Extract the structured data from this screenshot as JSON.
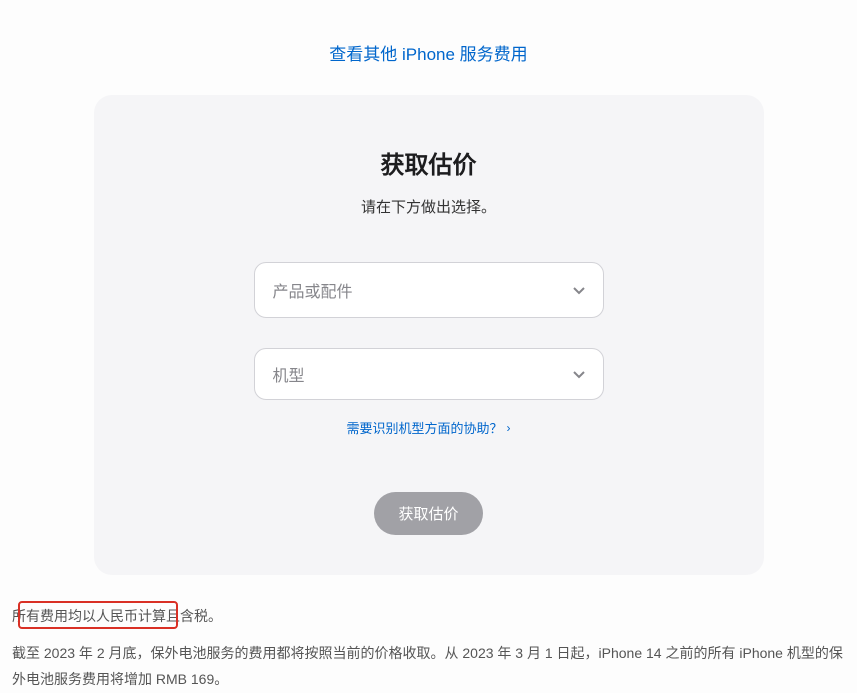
{
  "topLink": {
    "label": "查看其他 iPhone 服务费用"
  },
  "card": {
    "title": "获取估价",
    "subtitle": "请在下方做出选择。",
    "selectProduct": {
      "placeholder": "产品或配件"
    },
    "selectModel": {
      "placeholder": "机型"
    },
    "helpLink": {
      "label": "需要识别机型方面的协助？"
    },
    "submitButton": {
      "label": "获取估价"
    }
  },
  "footer": {
    "line1": "所有费用均以人民币计算且含税。",
    "line2": "截至 2023 年 2 月底，保外电池服务的费用都将按照当前的价格收取。从 2023 年 3 月 1 日起，iPhone 14 之前的所有 iPhone 机型的保外电池服务费用将增加 RMB 169。"
  }
}
